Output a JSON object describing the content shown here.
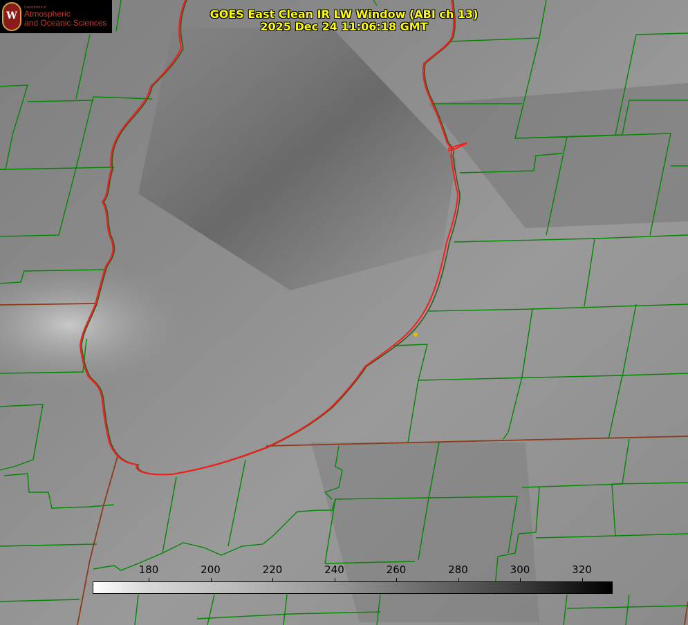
{
  "title": {
    "line1": "GOES East Clean IR LW Window (ABI ch 13)",
    "line2": "2025 Dec 24 11:06:18 GMT"
  },
  "logo": {
    "department": "Department of",
    "line1": "Atmospheric",
    "line2": "and Oceanic Sciences",
    "seal_letter": "W"
  },
  "colorbar": {
    "ticks": [
      "180",
      "200",
      "220",
      "240",
      "260",
      "280",
      "300",
      "320"
    ],
    "gradient": [
      "#ffffff",
      "#000000"
    ]
  },
  "colors": {
    "title": "#ffff00",
    "lake_outline": "#ff2020",
    "county_lines": "#008800",
    "state_lines": "#8b3a1a",
    "marker": "#e0c000"
  }
}
